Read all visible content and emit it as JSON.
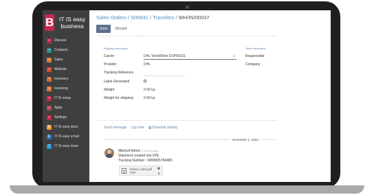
{
  "sidebar": {
    "brand_letter": "B",
    "brand_name": "IT IS easy business",
    "items": [
      {
        "label": "Discuss",
        "icon": "discuss-icon",
        "color": "#c8284a",
        "glyph": "▪"
      },
      {
        "label": "Contacts",
        "icon": "contacts-icon",
        "color": "#2f8f8a",
        "glyph": "▪"
      },
      {
        "label": "Sales",
        "icon": "sales-icon",
        "color": "#e07b39",
        "glyph": "▪"
      },
      {
        "label": "Website",
        "icon": "website-icon",
        "color": "#d4492f",
        "glyph": "▪"
      },
      {
        "label": "Inventory",
        "icon": "inventory-icon",
        "color": "#d66b2f",
        "glyph": "▪"
      },
      {
        "label": "Invoicing",
        "icon": "invoicing-icon",
        "color": "#e07b39",
        "glyph": "▪"
      },
      {
        "label": "IT IS setup",
        "icon": "setup-icon",
        "color": "#c8284a",
        "glyph": "▪"
      },
      {
        "label": "Apps",
        "icon": "apps-icon",
        "color": "#b24a57",
        "glyph": "▪"
      },
      {
        "label": "Settings",
        "icon": "settings-icon",
        "color": "#c8284a",
        "glyph": "▪"
      },
      {
        "label": "IT IS easy docs",
        "icon": "docs-icon",
        "color": "#f29a28",
        "glyph": "D"
      },
      {
        "label": "IT IS easy email",
        "icon": "email-icon",
        "color": "#1f77c6",
        "glyph": "E"
      },
      {
        "label": "IT IS easy team",
        "icon": "team-icon",
        "color": "#1f9bd6",
        "glyph": "T"
      }
    ]
  },
  "breadcrumb": {
    "part1": "Sales Orders",
    "sep1": " / ",
    "part2": "S00041",
    "sep2": " / ",
    "part3": "Transfers",
    "sep3": " / ",
    "current": "WH/IN/00037"
  },
  "toolbar": {
    "save_label": "Save",
    "discard_label": "Discard"
  },
  "form": {
    "shipping_title": "Shipping Information",
    "other_title": "Other Information",
    "carrier_label": "Carrier",
    "carrier_value": "DHL WorldWide EXPRESS",
    "provider_label": "Provider",
    "provider_value": "DHL",
    "tracking_label": "Tracking Reference",
    "tracking_value": "",
    "label_generated_label": "Label Generated",
    "weight_label": "Weight",
    "weight_value": "0.05 kg",
    "weight_shipping_label": "Weight for shipping",
    "weight_shipping_value": "0.00 kg",
    "responsible_label": "Responsible",
    "company_label": "Company"
  },
  "chatter": {
    "send_message": "Send message",
    "log_note": "Log note",
    "schedule_activity": "Schedule activity",
    "date": "November 2, 2022",
    "author": "Mitchell Admin",
    "time": "4 months ago",
    "line1": "Shipment created into DHL",
    "line2": "Tracking Number : 9999905784483",
    "attachment_name": "Return Label.pdf",
    "attachment_ext": "PDF"
  }
}
